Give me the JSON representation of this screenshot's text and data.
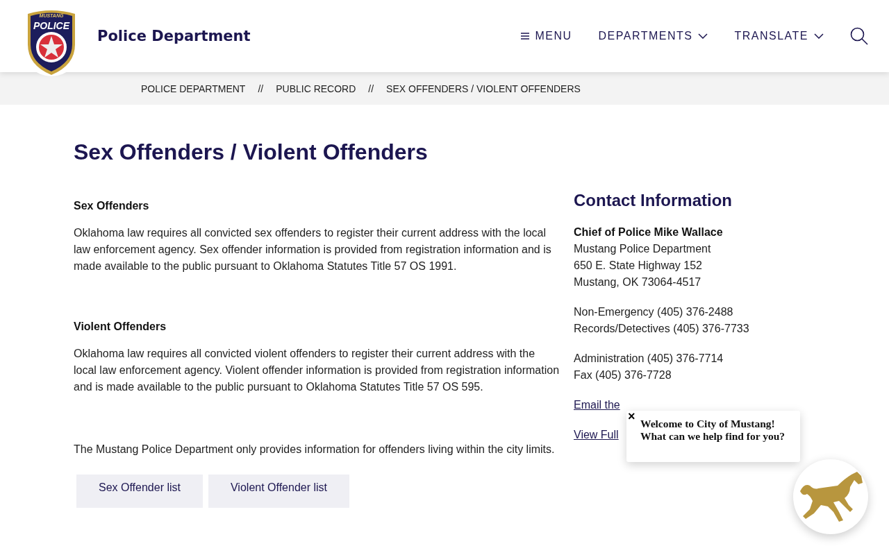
{
  "header": {
    "logo_text_top": "MUSTANG",
    "logo_text_main": "POLICE",
    "site_title": "Police Department",
    "nav": [
      {
        "label": "MENU",
        "kind": "menu"
      },
      {
        "label": "DEPARTMENTS",
        "kind": "dropdown"
      },
      {
        "label": "TRANSLATE",
        "kind": "dropdown"
      }
    ]
  },
  "breadcrumb": {
    "items": [
      "POLICE DEPARTMENT",
      "PUBLIC RECORD",
      "SEX OFFENDERS / VIOLENT OFFENDERS"
    ],
    "separator": "//"
  },
  "page_title": "Sex Offenders / Violent Offenders",
  "sections": [
    {
      "heading": "Sex Offenders",
      "body": "Oklahoma law requires all convicted sex offenders to register their current address with the local law enforcement agency. Sex offender information is provided from registration information and is made available to the public pursuant to Oklahoma Statutes Title 57 OS 1991."
    },
    {
      "heading": "Violent Offenders",
      "body": "Oklahoma law requires all convicted violent offenders to register their current address with the local law enforcement agency. Violent offender information is provided from registration information and is made available to the public pursuant to Oklahoma Statutes Title 57 OS 595."
    }
  ],
  "note": "The Mustang Police Department only provides information for offenders living within the city limits.",
  "buttons": [
    "Sex Offender list",
    "Violent Offender list"
  ],
  "contact": {
    "heading": "Contact Information",
    "name": "Chief of Police Mike Wallace",
    "blocks": [
      [
        "Mustang Police Department",
        "650 E. State Highway 152",
        "Mustang, OK 73064-4517"
      ],
      [
        "Non-Emergency (405) 376-2488",
        "Records/Detectives (405) 376-7733"
      ],
      [
        "Administration (405) 376-7714",
        "Fax (405) 376-7728"
      ]
    ],
    "links": [
      "Email the",
      "View Full"
    ]
  },
  "chat": {
    "close": "×",
    "message": "Welcome to City of Mustang! What can we help find for you?"
  }
}
